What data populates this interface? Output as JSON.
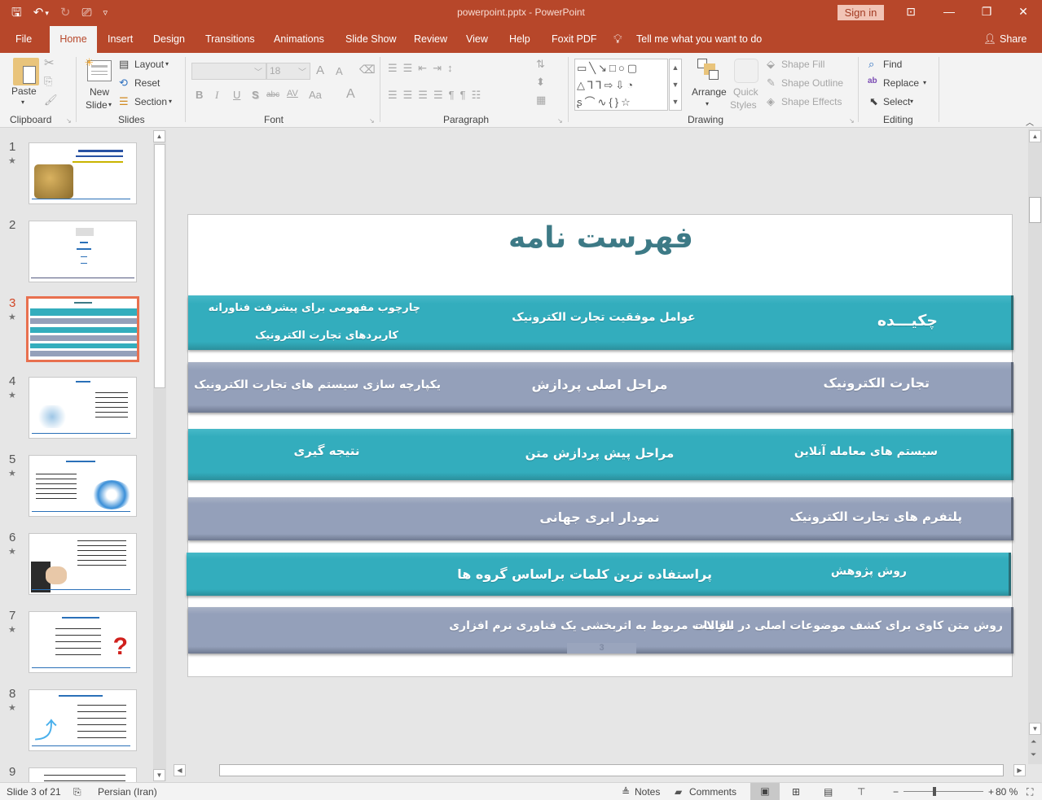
{
  "window": {
    "title": "powerpoint.pptx  -  PowerPoint",
    "sign_in": "Sign in",
    "controls": {
      "ribbon_display": "⊡",
      "minimize": "—",
      "restore": "❐",
      "close": "✕"
    }
  },
  "quick_access": {
    "save": "🖫",
    "undo": "↶",
    "undo_dropdown": "▾",
    "redo": "↻",
    "present": "⎚",
    "customize": "▿"
  },
  "tabs": [
    {
      "label": "File"
    },
    {
      "label": "Home",
      "active": true
    },
    {
      "label": "Insert"
    },
    {
      "label": "Design"
    },
    {
      "label": "Transitions"
    },
    {
      "label": "Animations"
    },
    {
      "label": "Slide Show"
    },
    {
      "label": "Review"
    },
    {
      "label": "View"
    },
    {
      "label": "Help"
    },
    {
      "label": "Foxit PDF"
    }
  ],
  "tell_me": "Tell me what you want to do",
  "share": "Share",
  "ribbon": {
    "clipboard": {
      "label": "Clipboard",
      "paste": "Paste"
    },
    "slides": {
      "label": "Slides",
      "new_slide_1": "New",
      "new_slide_2": "Slide",
      "layout": "Layout",
      "reset": "Reset",
      "section": "Section"
    },
    "font": {
      "label": "Font",
      "font_name": "",
      "font_size": "18",
      "bold": "B",
      "italic": "I",
      "underline": "U",
      "shadow": "S",
      "strike": "abc",
      "spacing": "AV",
      "case": "Aa",
      "color": "A",
      "grow": "A",
      "shrink": "A"
    },
    "paragraph": {
      "label": "Paragraph"
    },
    "drawing": {
      "label": "Drawing",
      "arrange": "Arrange",
      "quick_styles_1": "Quick",
      "quick_styles_2": "Styles",
      "shape_fill": "Shape Fill",
      "shape_outline": "Shape Outline",
      "shape_effects": "Shape Effects"
    },
    "editing": {
      "label": "Editing",
      "find": "Find",
      "replace": "Replace",
      "select": "Select"
    }
  },
  "thumbnails": [
    {
      "num": "1",
      "title": "",
      "selected": false
    },
    {
      "num": "2",
      "title": "",
      "selected": false
    },
    {
      "num": "3",
      "title": "فهرست نامه",
      "selected": true
    },
    {
      "num": "4",
      "title": "چکیده",
      "selected": false
    },
    {
      "num": "5",
      "title": "تجارت الکترونیک",
      "selected": false
    },
    {
      "num": "6",
      "title": "",
      "selected": false
    },
    {
      "num": "7",
      "title": "سیستم های معامله آنلاین",
      "selected": false
    },
    {
      "num": "8",
      "title": "پلتفرم های تجارت الکترونیک",
      "selected": false
    },
    {
      "num": "9",
      "title": "",
      "selected": false
    }
  ],
  "slide": {
    "title": "فهرست نامه",
    "page_number": "3",
    "rows": [
      {
        "color": "teal",
        "cells": [
          "چکیـــده",
          "عوامل موفقیت تجارت الکترونیک",
          "چارچوب مفهومی برای پیشرفت فناورانه",
          "کاربردهای تجارت الکترونیک"
        ]
      },
      {
        "color": "gray",
        "cells": [
          "تجارت الکترونیک",
          "مراحل اصلی پردازش",
          "یکپارچه سازی سیستم های تجارت الکترونیک"
        ]
      },
      {
        "color": "teal",
        "cells": [
          "سیستم های معامله آنلاین",
          "مراحل پیش پردازش متن",
          "نتیجه گیری"
        ]
      },
      {
        "color": "gray",
        "cells": [
          "پلتفرم های تجارت الکترونیک",
          "نمودار ابری جهانی"
        ]
      },
      {
        "color": "teal",
        "cells": [
          "روش پژوهش",
          "پراستفاده ترین کلمات براساس گروه ها"
        ]
      },
      {
        "color": "gray",
        "cells": [
          "روش متن کاوی برای کشف موضوعات اصلی در مقالات",
          "الزامات مربوط به اثربخشی یک فناوری نرم افزاری"
        ]
      }
    ]
  },
  "status": {
    "slide_info": "Slide 3 of 21",
    "language": "Persian (Iran)",
    "notes": "Notes",
    "comments": "Comments",
    "zoom": "80 %",
    "zoom_level_percent": 80
  },
  "colors": {
    "accent": "#b7472a",
    "teal_band": "#33adbd",
    "gray_band": "#94a0ba",
    "title": "#3d7a86",
    "selected_thumb": "#e8704f"
  }
}
